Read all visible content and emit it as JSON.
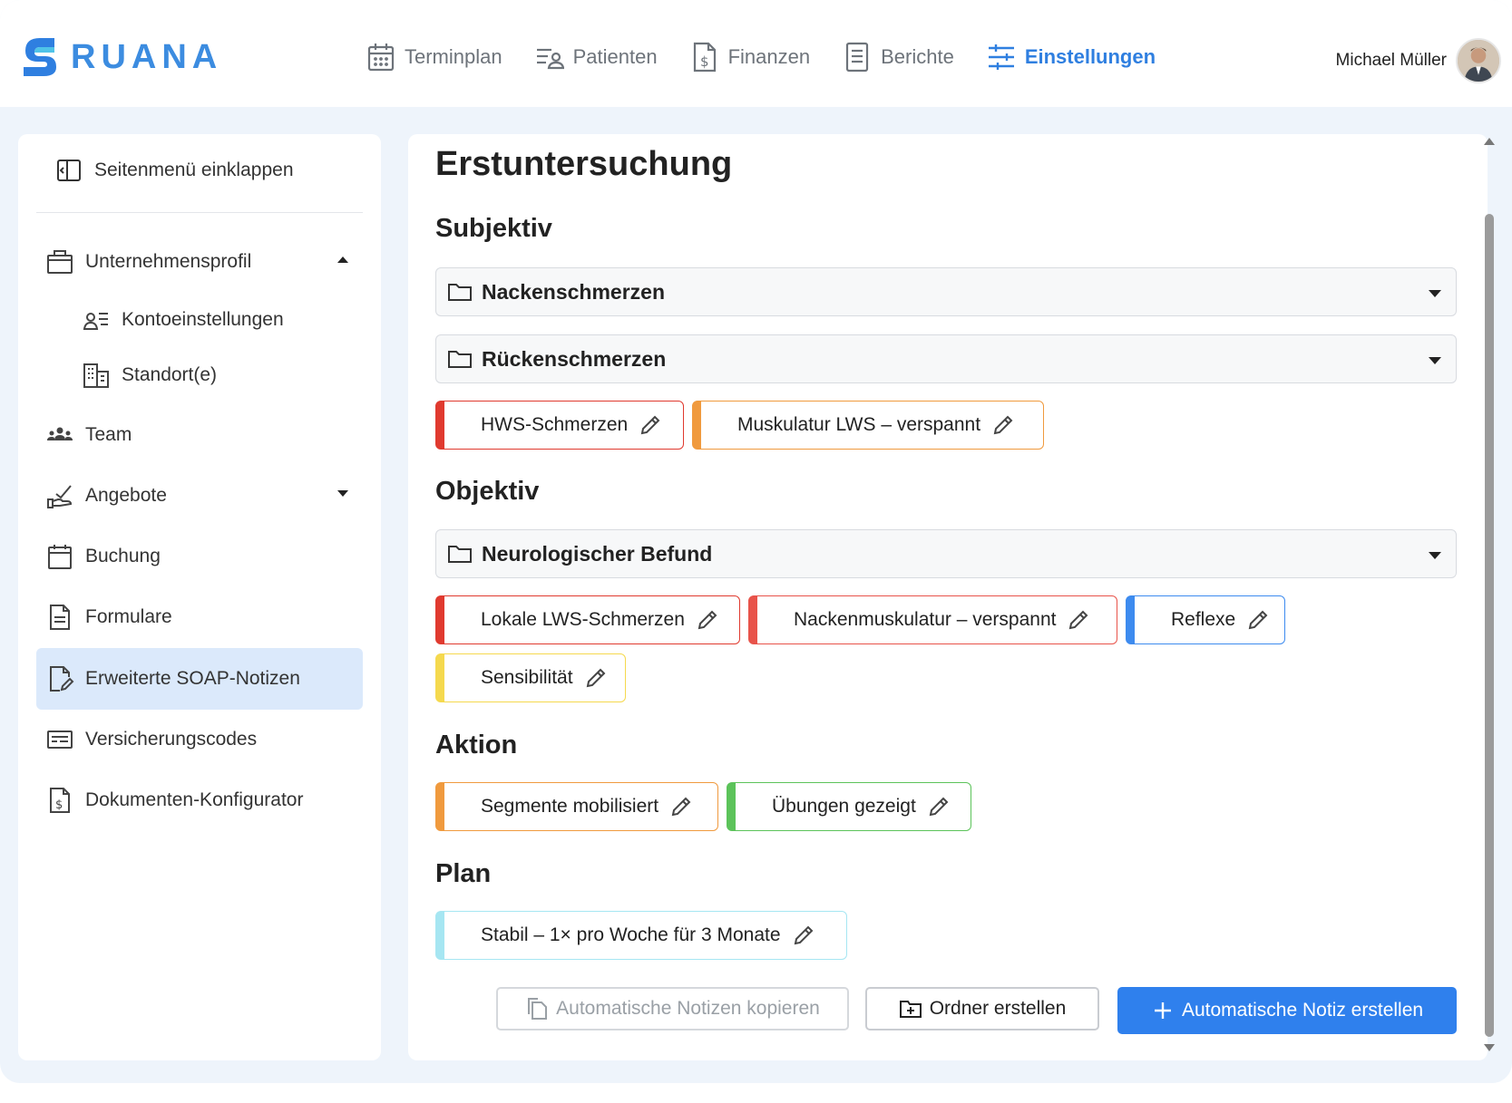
{
  "brand": {
    "name": "RUANA",
    "color": "#3c8ce0"
  },
  "nav": [
    {
      "label": "Terminplan",
      "icon": "calendar-icon",
      "active": false
    },
    {
      "label": "Patienten",
      "icon": "patients-icon",
      "active": false
    },
    {
      "label": "Finanzen",
      "icon": "finance-icon",
      "active": false
    },
    {
      "label": "Berichte",
      "icon": "reports-icon",
      "active": false
    },
    {
      "label": "Einstellungen",
      "icon": "settings-sliders-icon",
      "active": true
    }
  ],
  "user": {
    "name": "Michael Müller"
  },
  "sidebar": {
    "collapse_label": "Seitenmenü einklappen",
    "items": [
      {
        "label": "Unternehmensprofil",
        "icon": "briefcase-icon",
        "expanded": true
      },
      {
        "label": "Kontoeinstellungen",
        "icon": "account-settings-icon"
      },
      {
        "label": "Standort(e)",
        "icon": "building-icon"
      },
      {
        "label": "Team",
        "icon": "team-icon"
      },
      {
        "label": "Angebote",
        "icon": "offer-hand-icon",
        "expanded": false
      },
      {
        "label": "Buchung",
        "icon": "calendar-icon"
      },
      {
        "label": "Formulare",
        "icon": "form-document-icon"
      },
      {
        "label": "Erweiterte SOAP-Notizen",
        "icon": "edit-document-icon",
        "active": true
      },
      {
        "label": "Versicherungscodes",
        "icon": "insurance-card-icon"
      },
      {
        "label": "Dokumenten-Konfigurator",
        "icon": "dollar-document-icon"
      }
    ]
  },
  "main": {
    "title": "Erstuntersuchung",
    "sections": {
      "subjektiv": {
        "title": "Subjektiv",
        "folders": [
          "Nackenschmerzen",
          "Rückenschmerzen"
        ],
        "chips": [
          {
            "label": "HWS-Schmerzen",
            "color": "#e03a2f"
          },
          {
            "label": "Muskulatur LWS – verspannt",
            "color": "#f09a3e"
          }
        ]
      },
      "objektiv": {
        "title": "Objektiv",
        "folders": [
          "Neurologischer Befund"
        ],
        "chips": [
          {
            "label": "Lokale LWS-Schmerzen",
            "color": "#e03a2f"
          },
          {
            "label": "Nackenmuskulatur – verspannt",
            "color": "#e8534a"
          },
          {
            "label": "Reflexe",
            "color": "#3d8bef"
          },
          {
            "label": "Sensibilität",
            "color": "#f5d94e"
          }
        ]
      },
      "aktion": {
        "title": "Aktion",
        "chips": [
          {
            "label": "Segmente mobilisiert",
            "color": "#f09a3e"
          },
          {
            "label": "Übungen gezeigt",
            "color": "#5cc35a"
          }
        ]
      },
      "plan": {
        "title": "Plan",
        "chips": [
          {
            "label": "Stabil – 1× pro Woche für 3 Monate",
            "color": "#a6e6f2"
          }
        ]
      }
    },
    "buttons": {
      "copy": "Automatische Notizen kopieren",
      "folder": "Ordner erstellen",
      "create": "Automatische Notiz erstellen"
    }
  }
}
